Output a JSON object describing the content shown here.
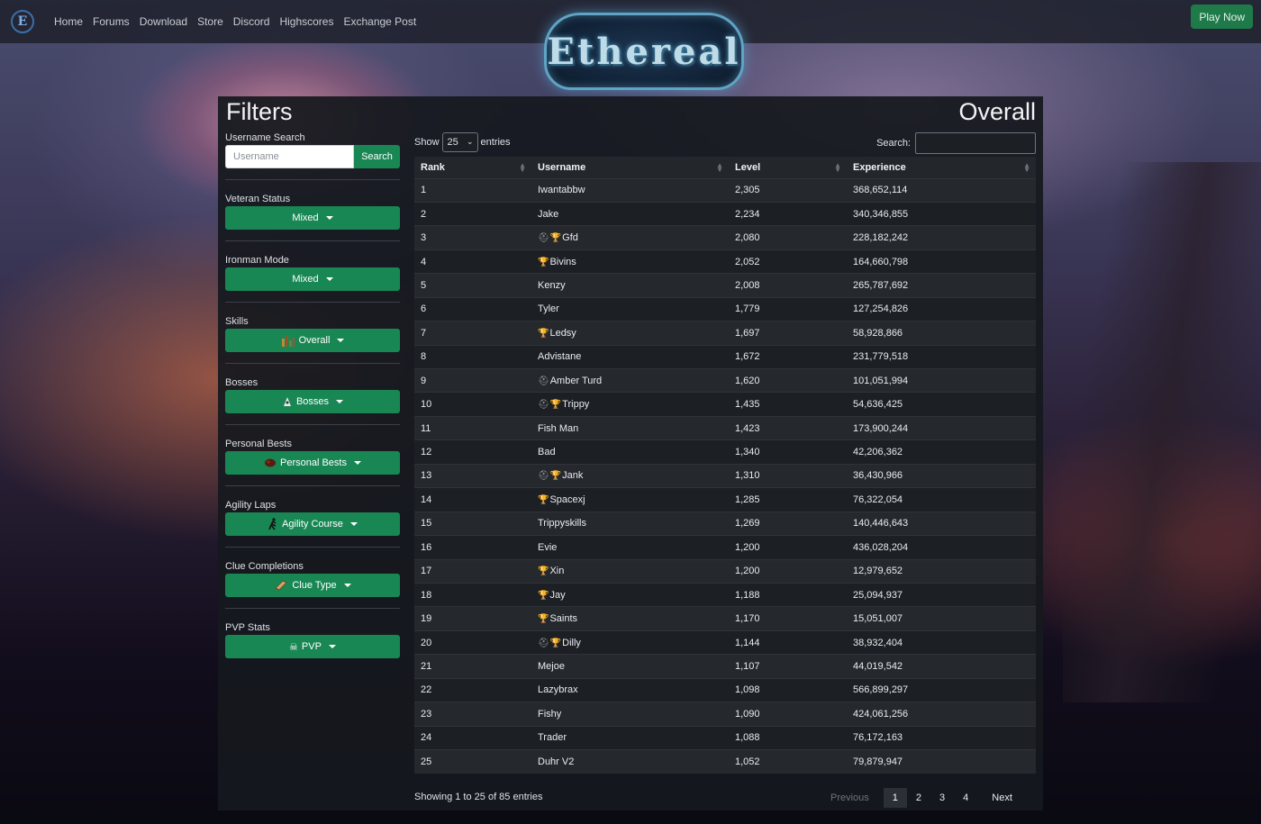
{
  "nav": {
    "brand": "E",
    "links": [
      "Home",
      "Forums",
      "Download",
      "Store",
      "Discord",
      "Highscores",
      "Exchange Post"
    ],
    "play_label": "Play Now"
  },
  "logo_text": "Ethereal",
  "filters": {
    "title": "Filters",
    "username_search_label": "Username Search",
    "username_placeholder": "Username",
    "search_button": "Search",
    "veteran_label": "Veteran Status",
    "veteran_value": "Mixed",
    "ironman_label": "Ironman Mode",
    "ironman_value": "Mixed",
    "skills_label": "Skills",
    "skills_value": "Overall",
    "bosses_label": "Bosses",
    "bosses_value": "Bosses",
    "pb_label": "Personal Bests",
    "pb_value": "Personal Bests",
    "agility_label": "Agility Laps",
    "agility_value": "Agility Course",
    "clue_label": "Clue Completions",
    "clue_value": "Clue Type",
    "pvp_label": "PVP Stats",
    "pvp_value": "PVP"
  },
  "table": {
    "title": "Overall",
    "show_label": "Show",
    "entries_label": "entries",
    "length_value": "25",
    "search_label": "Search:",
    "headers": [
      "Rank",
      "Username",
      "Level",
      "Experience"
    ],
    "rows": [
      {
        "rank": "1",
        "name": "Iwantabbw",
        "iron": false,
        "trophy": false,
        "level": "2,305",
        "xp": "368,652,114"
      },
      {
        "rank": "2",
        "name": "Jake",
        "iron": false,
        "trophy": false,
        "level": "2,234",
        "xp": "340,346,855"
      },
      {
        "rank": "3",
        "name": "Gfd",
        "iron": true,
        "trophy": true,
        "level": "2,080",
        "xp": "228,182,242"
      },
      {
        "rank": "4",
        "name": "Bivins",
        "iron": false,
        "trophy": true,
        "level": "2,052",
        "xp": "164,660,798"
      },
      {
        "rank": "5",
        "name": "Kenzy",
        "iron": false,
        "trophy": false,
        "level": "2,008",
        "xp": "265,787,692"
      },
      {
        "rank": "6",
        "name": "Tyler",
        "iron": false,
        "trophy": false,
        "level": "1,779",
        "xp": "127,254,826"
      },
      {
        "rank": "7",
        "name": "Ledsy",
        "iron": false,
        "trophy": true,
        "level": "1,697",
        "xp": "58,928,866"
      },
      {
        "rank": "8",
        "name": "Advistane",
        "iron": false,
        "trophy": false,
        "level": "1,672",
        "xp": "231,779,518"
      },
      {
        "rank": "9",
        "name": "Amber Turd",
        "iron": true,
        "trophy": false,
        "level": "1,620",
        "xp": "101,051,994"
      },
      {
        "rank": "10",
        "name": "Trippy",
        "iron": true,
        "trophy": true,
        "level": "1,435",
        "xp": "54,636,425"
      },
      {
        "rank": "11",
        "name": "Fish Man",
        "iron": false,
        "trophy": false,
        "level": "1,423",
        "xp": "173,900,244"
      },
      {
        "rank": "12",
        "name": "Bad",
        "iron": false,
        "trophy": false,
        "level": "1,340",
        "xp": "42,206,362"
      },
      {
        "rank": "13",
        "name": "Jank",
        "iron": true,
        "trophy": true,
        "level": "1,310",
        "xp": "36,430,966"
      },
      {
        "rank": "14",
        "name": "Spacexj",
        "iron": false,
        "trophy": true,
        "level": "1,285",
        "xp": "76,322,054"
      },
      {
        "rank": "15",
        "name": "Trippyskills",
        "iron": false,
        "trophy": false,
        "level": "1,269",
        "xp": "140,446,643"
      },
      {
        "rank": "16",
        "name": "Evie",
        "iron": false,
        "trophy": false,
        "level": "1,200",
        "xp": "436,028,204"
      },
      {
        "rank": "17",
        "name": "Xin",
        "iron": false,
        "trophy": true,
        "level": "1,200",
        "xp": "12,979,652"
      },
      {
        "rank": "18",
        "name": "Jay",
        "iron": false,
        "trophy": true,
        "level": "1,188",
        "xp": "25,094,937"
      },
      {
        "rank": "19",
        "name": "Saints",
        "iron": false,
        "trophy": true,
        "level": "1,170",
        "xp": "15,051,007"
      },
      {
        "rank": "20",
        "name": "Dilly",
        "iron": true,
        "trophy": true,
        "level": "1,144",
        "xp": "38,932,404"
      },
      {
        "rank": "21",
        "name": "Mejoe",
        "iron": false,
        "trophy": false,
        "level": "1,107",
        "xp": "44,019,542"
      },
      {
        "rank": "22",
        "name": "Lazybrax",
        "iron": false,
        "trophy": false,
        "level": "1,098",
        "xp": "566,899,297"
      },
      {
        "rank": "23",
        "name": "Fishy",
        "iron": false,
        "trophy": false,
        "level": "1,090",
        "xp": "424,061,256"
      },
      {
        "rank": "24",
        "name": "Trader",
        "iron": false,
        "trophy": false,
        "level": "1,088",
        "xp": "76,172,163"
      },
      {
        "rank": "25",
        "name": "Duhr V2",
        "iron": false,
        "trophy": false,
        "level": "1,052",
        "xp": "79,879,947"
      }
    ],
    "info": "Showing 1 to 25 of 85 entries",
    "pager": {
      "previous": "Previous",
      "pages": [
        "1",
        "2",
        "3",
        "4"
      ],
      "active": "1",
      "next": "Next"
    }
  },
  "colors": {
    "accent": "#198754",
    "play": "#1f7a4a",
    "panel": "#16191e"
  },
  "icons": {
    "iron": "ironman-helmet-icon",
    "trophy": "trophy-icon"
  }
}
